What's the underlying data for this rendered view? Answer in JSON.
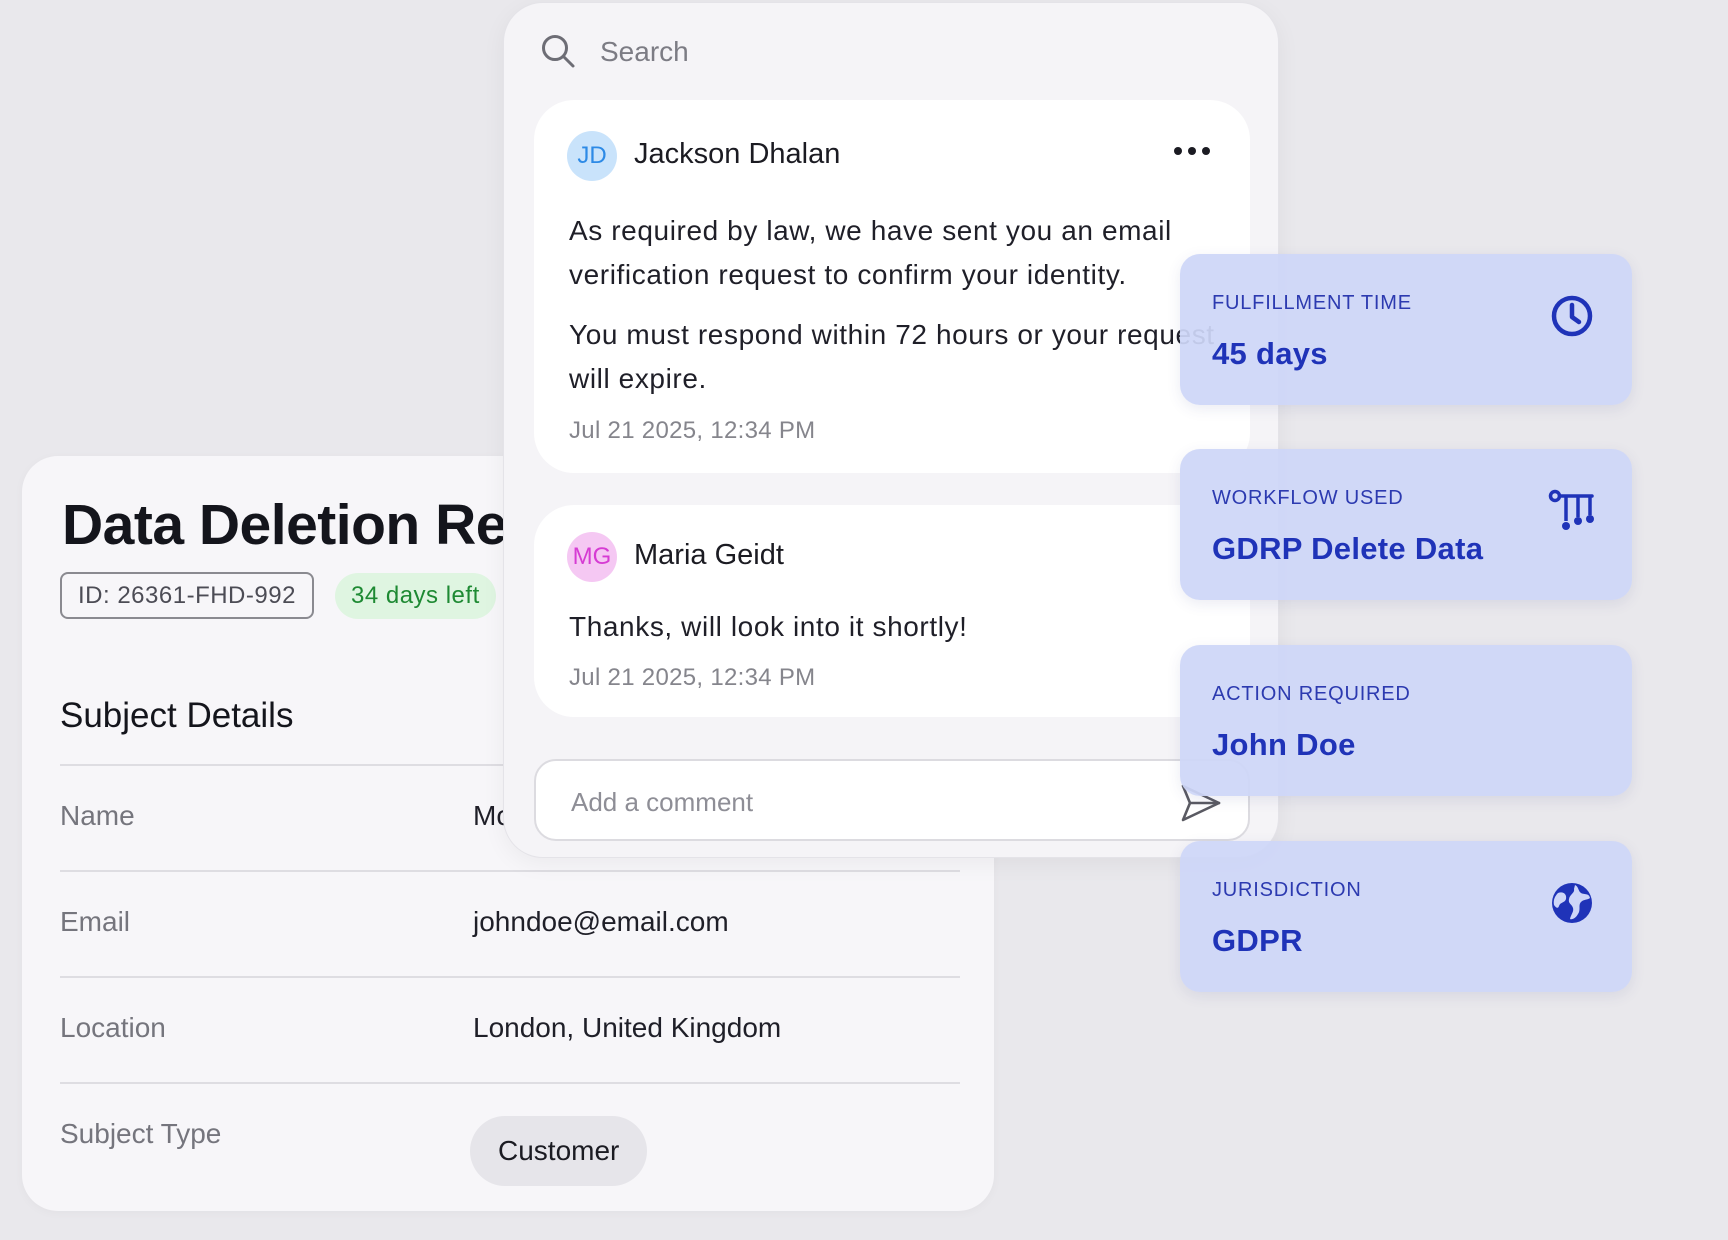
{
  "request": {
    "title": "Data Deletion Re",
    "id_badge": "ID: 26361-FHD-992",
    "days_left": "34 days left",
    "section_title": "Subject Details",
    "fields": [
      {
        "label": "Name",
        "value": "Mc"
      },
      {
        "label": "Email",
        "value": "johndoe@email.com"
      },
      {
        "label": "Location",
        "value": "London, United Kingdom"
      },
      {
        "label": "Subject Type",
        "value": "Customer"
      }
    ]
  },
  "comments": {
    "search_placeholder": "Search",
    "items": [
      {
        "initials": "JD",
        "author": "Jackson Dhalan",
        "paragraphs": [
          "As required by law, we have sent you an email verification request to confirm your identity.",
          "You must respond within 72 hours or your request will expire."
        ],
        "timestamp": "Jul 21 2025, 12:34 PM"
      },
      {
        "initials": "MG",
        "author": "Maria Geidt",
        "paragraphs": [
          "Thanks, will look into it shortly!"
        ],
        "timestamp": "Jul 21 2025, 12:34 PM"
      }
    ],
    "input_placeholder": "Add a comment"
  },
  "info_cards": [
    {
      "label": "FULFILLMENT TIME",
      "value": "45 days",
      "icon": "clock-icon"
    },
    {
      "label": "WORKFLOW USED",
      "value": "GDRP Delete Data",
      "icon": "workflow-icon"
    },
    {
      "label": "ACTION REQUIRED",
      "value": "John Doe",
      "icon": ""
    },
    {
      "label": "JURISDICTION",
      "value": "GDPR",
      "icon": "globe-icon"
    }
  ],
  "colors": {
    "background": "#e9e8ec",
    "accent": "#1f33b8",
    "info_card_bg": "#ced6f8",
    "days_left_bg": "#dff5e1",
    "days_left_text": "#1e8a33",
    "avatar_jd": "#2d8ae6",
    "avatar_mg": "#d63cd3"
  }
}
